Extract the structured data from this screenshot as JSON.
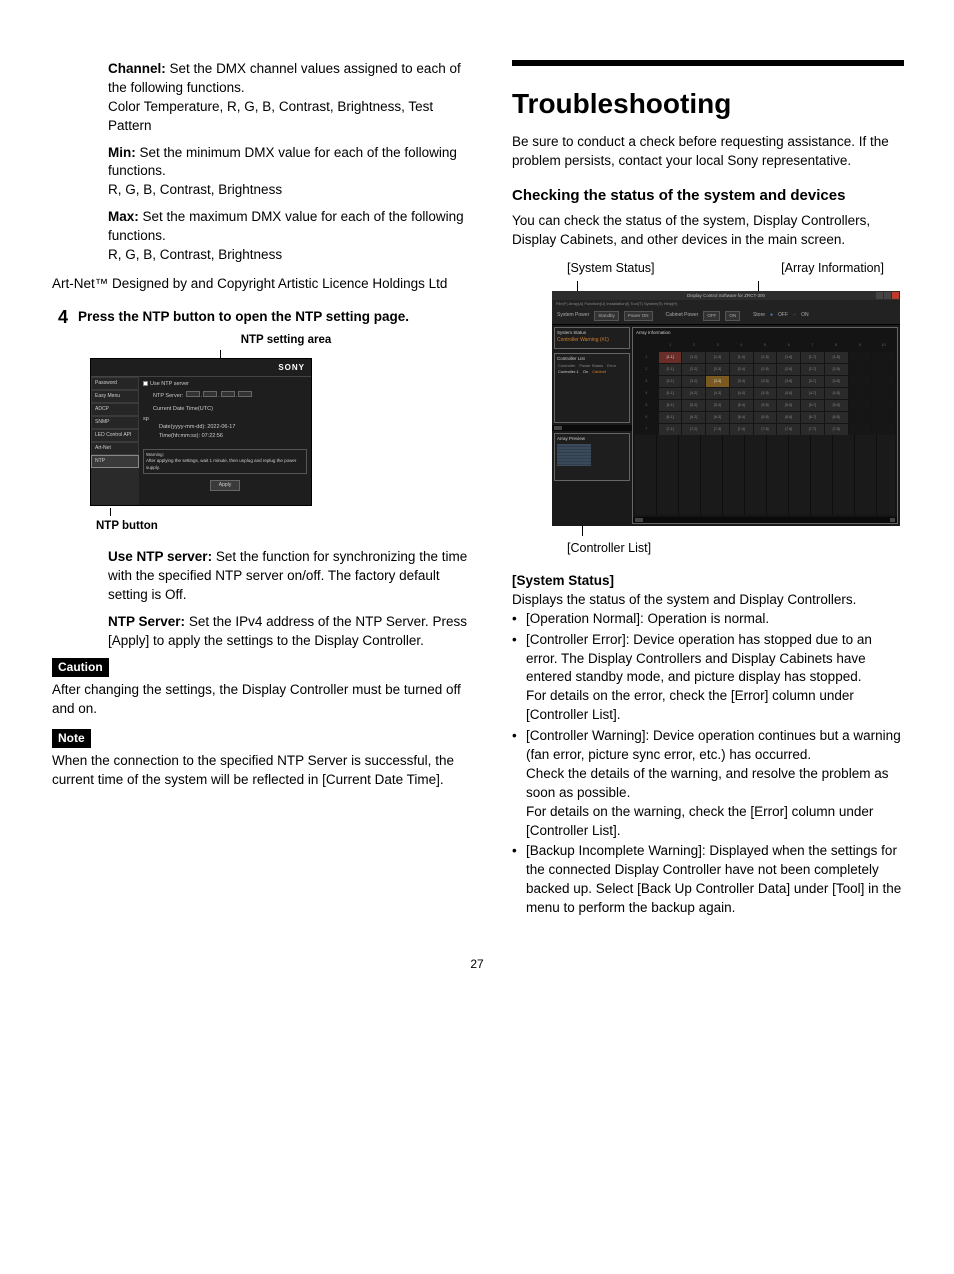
{
  "left": {
    "defs": [
      {
        "term": "Channel:",
        "body": "Set the DMX channel values assigned to each of the following functions.",
        "sub": "Color Temperature, R, G, B, Contrast, Brightness, Test Pattern"
      },
      {
        "term": "Min:",
        "body": "Set the minimum DMX value for each of the following functions.",
        "sub": "R, G, B, Contrast, Brightness"
      },
      {
        "term": "Max:",
        "body": "Set the maximum DMX value for each of the following functions.",
        "sub": "R, G, B, Contrast, Brightness"
      }
    ],
    "artnet": "Art-Net™ Designed by and Copyright Artistic Licence Holdings Ltd",
    "step4_num": "4",
    "step4_text": "Press the NTP button to open the NTP setting page.",
    "fig1_top": "NTP setting area",
    "fig1_bottom": "NTP button",
    "shot1": {
      "brand": "SONY",
      "side_items": [
        "Password",
        "Easy Menu",
        "ADCP",
        "SNMP",
        "LED Control API",
        "Art-Net",
        "NTP"
      ],
      "use_ntp": "Use NTP server",
      "ntp_server_label": "NTP Server:",
      "current_label": "Current Date Time(UTC)",
      "date_line": "Date(yyyy-mm-dd):   2022-06-17",
      "time_line": "Time(hh:mm:ss):      07:22:56",
      "warn_title": "Warning:",
      "warn_body": "After applying the settings, wait 1 minute, then unplug and replug the power supply.",
      "apply": "Apply"
    },
    "defs2": [
      {
        "term": "Use NTP server:",
        "body": "Set the function for synchronizing the time with the specified NTP server on/off. The factory default setting is Off."
      },
      {
        "term": "NTP Server:",
        "body": "Set the IPv4 address of the NTP Server. Press [Apply] to apply the settings to the Display Controller."
      }
    ],
    "caution_label": "Caution",
    "caution_text": "After changing the settings, the Display Controller must be turned off and on.",
    "note_label": "Note",
    "note_text": "When the connection to the specified NTP Server is successful, the current time of the system will be reflected in [Current Date Time]."
  },
  "right": {
    "title": "Troubleshooting",
    "intro": "Be sure to conduct a check before requesting assistance. If the problem persists, contact your local Sony representative.",
    "h2": "Checking the status of the system and devices",
    "h2_intro": "You can check the status of the system, Display Controllers, Display Cabinets, and other devices in the main screen.",
    "labels": {
      "sys": "[System Status]",
      "arr": "[Array Information]",
      "ctrl": "[Controller List]"
    },
    "shot2": {
      "title": "Display Control Software for ZRCT-300",
      "menu": "File(F)  Array(A)  Function(U)  Installation(I)  Tool(T)  System(S)  Help(H)",
      "system_power": "System Power",
      "standby": "Standby",
      "power_on": "Power ON",
      "cabinet_power": "Cabinet Power",
      "off": "OFF",
      "on": "ON",
      "store": "Store",
      "sys_status": "System Status",
      "ctrl_warning": "Controller Warning (#1)",
      "ctrl_list": "Controller List",
      "ctrl_list_hdr": [
        "Controller",
        "Power Status",
        "Error"
      ],
      "ctrl_list_row": [
        "Controller-1",
        "On",
        "Cabinet"
      ],
      "array_preview": "Array Preview",
      "array_info": "Array Information"
    },
    "sys_h": "[System Status]",
    "sys_p": "Displays the status of the system and Display Controllers.",
    "bullets": [
      {
        "lead": "[Operation Normal]: Operation is normal."
      },
      {
        "lead": "[Controller Error]: Device operation has stopped due to an error. The Display Controllers and Display Cabinets have entered standby mode, and picture display has stopped.",
        "tail": "For details on the error, check the [Error] column under [Controller List]."
      },
      {
        "lead": "[Controller Warning]: Device operation continues but a warning (fan error, picture sync error, etc.) has occurred.",
        "mid": "Check the details of the warning, and resolve the problem as soon as possible.",
        "tail": "For details on the warning, check the [Error] column under [Controller List]."
      },
      {
        "lead": "[Backup Incomplete Warning]: Displayed when the settings for the connected Display Controller have not been completely backed up. Select [Back Up Controller Data] under [Tool] in the menu to perform the backup again."
      }
    ]
  },
  "page_number": "27"
}
